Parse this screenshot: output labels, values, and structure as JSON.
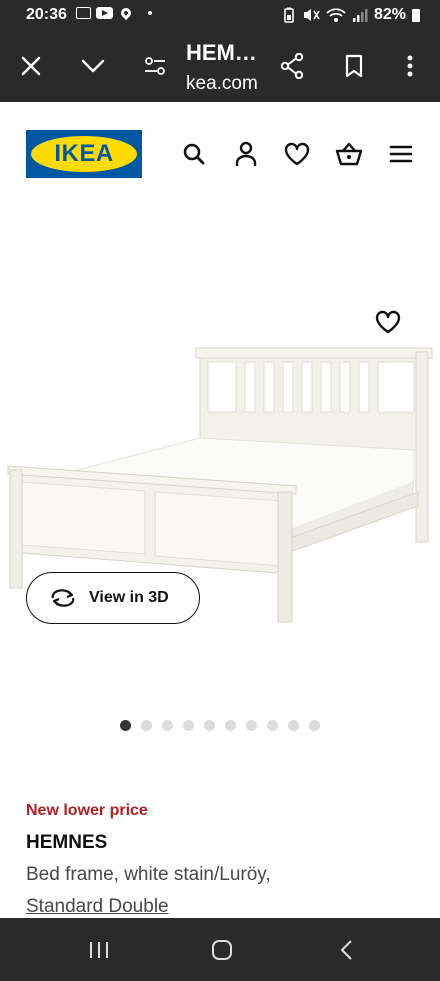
{
  "status_bar": {
    "time": "20:36",
    "battery": "82%"
  },
  "browser": {
    "page_title": "HEM…",
    "url": "kea.com",
    "icons": [
      "close-icon",
      "chevron-down-icon",
      "page-settings-icon",
      "share-icon",
      "bookmark-icon",
      "more-vertical-icon"
    ]
  },
  "site_header": {
    "logo_text": "IKEA",
    "icons": [
      "search-icon",
      "account-icon",
      "heart-icon",
      "basket-icon",
      "menu-icon"
    ]
  },
  "product_image": {
    "view_3d_label": "View in 3D",
    "carousel_total": 10,
    "carousel_active_index": 0
  },
  "product": {
    "price_tag": "New lower price",
    "name": "HEMNES",
    "description": "Bed frame, white stain/Luröy,",
    "size": "Standard Double"
  },
  "colors": {
    "ikea_blue": "#0058a3",
    "ikea_yellow": "#ffdb00",
    "price_red": "#b31f25",
    "system_bar": "#2a2a2a"
  }
}
